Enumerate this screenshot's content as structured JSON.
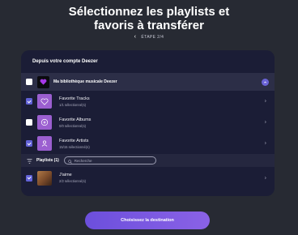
{
  "page": {
    "title_line1": "Sélectionnez les playlists et",
    "title_line2": "favoris à transférer",
    "step_label": "ÉTAPE 2/4"
  },
  "card": {
    "header": "Depuis votre compte Deezer",
    "library": {
      "label": "Ma bibliothèque musicale Deezer",
      "checked": false
    },
    "favorites": [
      {
        "title": "Favorite Tracks",
        "subtitle": "1/1 sélectionné(s)",
        "checked": true,
        "icon": "heart-icon",
        "color": "#9b5fd0"
      },
      {
        "title": "Favorite Albums",
        "subtitle": "0/0 sélectionné(s)",
        "checked": false,
        "icon": "disc-icon",
        "color": "#9b5fd0"
      },
      {
        "title": "Favorite Artists",
        "subtitle": "15/15 sélectionné(s)",
        "checked": true,
        "icon": "person-icon",
        "color": "#9b5fd0"
      }
    ],
    "playlists_label": "Playlists (1)",
    "search_placeholder": "Recherche",
    "playlists": [
      {
        "title": "J'aime",
        "subtitle": "2/2 sélectionné(s)",
        "checked": true
      }
    ]
  },
  "cta_label": "Choisissez la destination",
  "colors": {
    "background": "#272a33",
    "card": "#1b1d36",
    "accent": "#6262d8",
    "cta_start": "#6c4fdc",
    "cta_end": "#8a62e6"
  }
}
